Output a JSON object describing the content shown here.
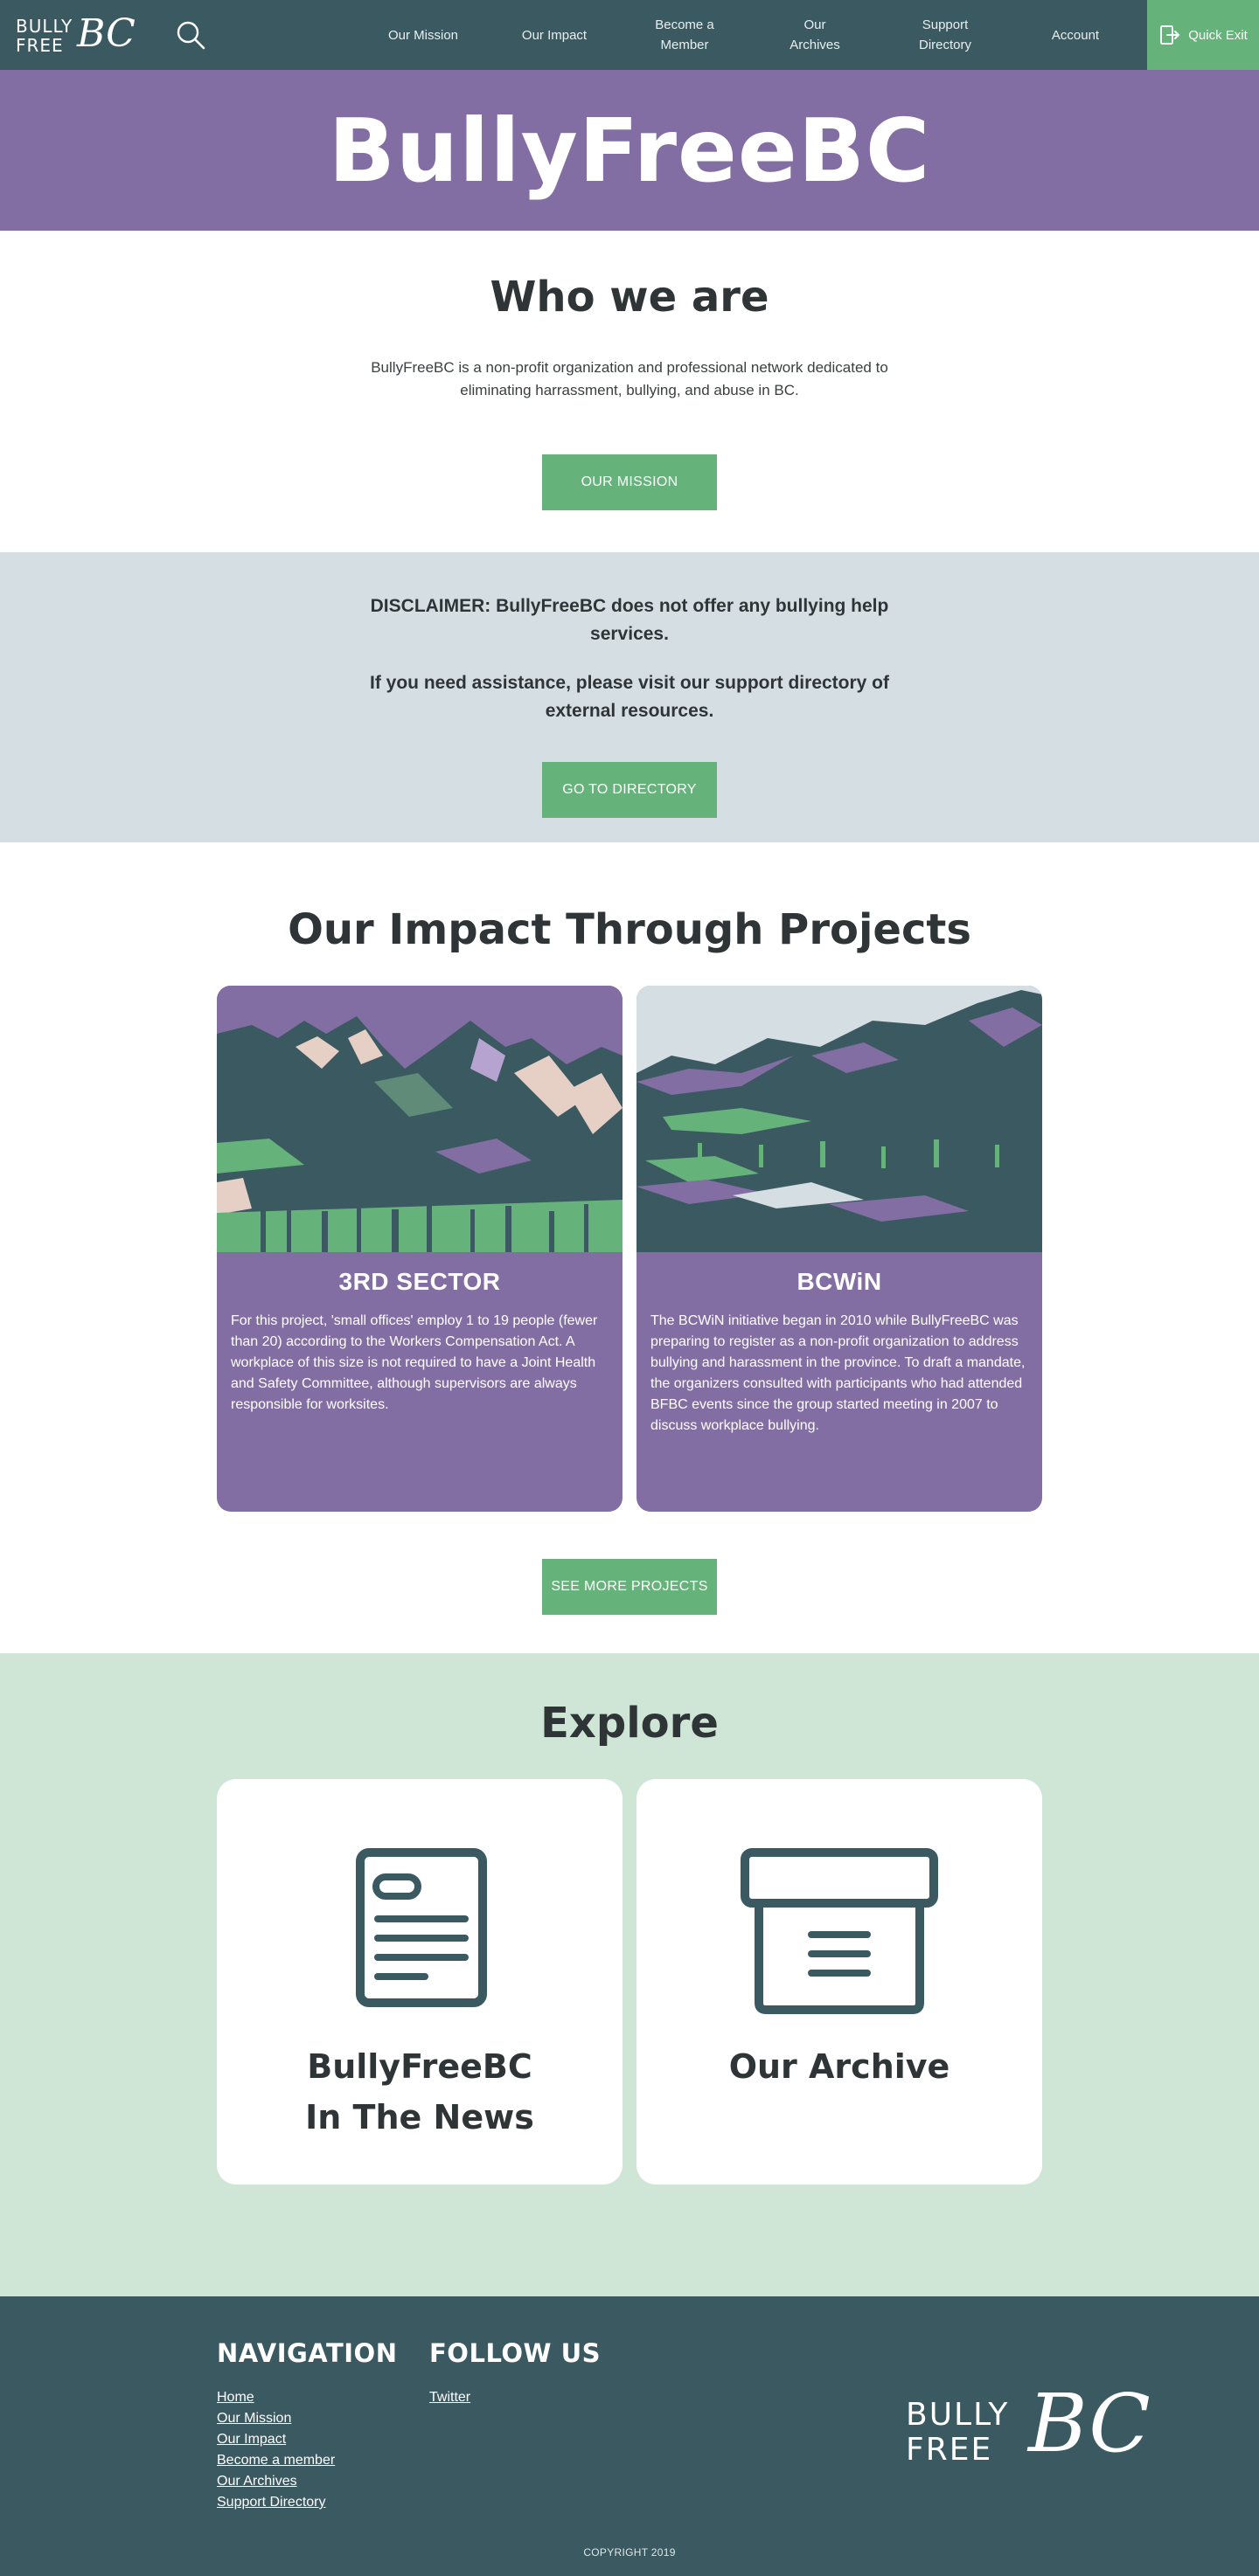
{
  "nav": {
    "logo_text": "BULLY\nFREE",
    "logo_script": "BC",
    "links": [
      "Our Mission",
      "Our Impact",
      "Become a\nMember",
      "Our\nArchives",
      "Support\nDirectory",
      "Account"
    ],
    "quick_exit": "Quick Exit"
  },
  "hero": {
    "title": "BullyFreeBC"
  },
  "who": {
    "title": "Who we are",
    "text": "BullyFreeBC is a non-profit organization and professional network dedicated to eliminating harrassment, bullying, and abuse in BC.",
    "button": "OUR MISSION"
  },
  "disclaimer": {
    "line1": "DISCLAIMER: BullyFreeBC does not offer any bullying help services.",
    "line2": "If you need assistance, please visit our support directory of external resources.",
    "button": "GO TO DIRECTORY"
  },
  "impact": {
    "title": "Our Impact Through Projects",
    "cards": [
      {
        "title": "3RD SECTOR",
        "text": "For this project, 'small offices' employ 1 to 19 people (fewer than 20) according to the Workers Compensation Act. A workplace of this size is not required to have a Joint Health and Safety Committee, although supervisors are always responsible for worksites."
      },
      {
        "title": "BCWiN",
        "text": "The BCWiN initiative began in 2010 while BullyFreeBC was preparing to register as a non-profit organization to address bullying and harassment in the province. To draft a mandate, the organizers consulted with participants who had attended BFBC events since the group started meeting in 2007 to discuss workplace bullying."
      }
    ],
    "button": "SEE MORE PROJECTS"
  },
  "explore": {
    "title": "Explore",
    "cards": [
      {
        "title_line1": "BullyFreeBC",
        "title_line2": "In The News",
        "icon": "document-icon"
      },
      {
        "title_line1": "Our Archive",
        "icon": "archive-box-icon"
      }
    ]
  },
  "footer": {
    "nav_heading": "NAVIGATION",
    "nav_links": [
      "Home",
      "Our Mission",
      "Our Impact",
      "Become a member",
      "Our Archives",
      "Support Directory"
    ],
    "follow_heading": "FOLLOW US",
    "follow_links": [
      "Twitter"
    ],
    "logo_text": "BULLY\nFREE",
    "logo_script": "BC",
    "copyright": "COPYRIGHT 2019"
  },
  "colors": {
    "nav_bg": "#3b5961",
    "purple": "#836ea3",
    "green_button": "#65b27a",
    "disclaimer_bg": "#d5dfe3",
    "explore_bg": "#cfe5d6",
    "text_dark": "#2f3536"
  }
}
